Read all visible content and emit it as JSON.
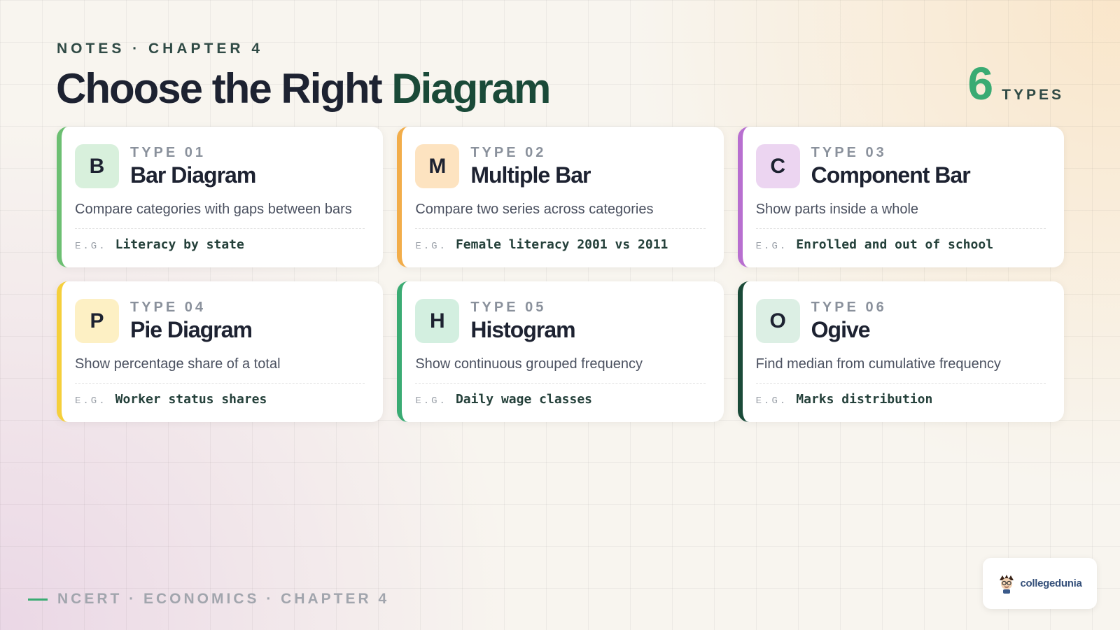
{
  "header": {
    "eyebrow": "NOTES · CHAPTER 4",
    "title_main": "Choose the Right",
    "title_accent": "Diagram",
    "count_value": "6",
    "count_label": "TYPES"
  },
  "colors": {
    "accent_green": "#3aab73",
    "dark_green": "#1a4a38",
    "title_dark": "#1d2231"
  },
  "example_prefix": "E.G.",
  "cards": [
    {
      "letter": "B",
      "type_label": "TYPE 01",
      "title": "Bar Diagram",
      "description": "Compare categories with gaps between bars",
      "example": "Literacy by state",
      "border_color": "#6cbf72",
      "badge_color": "#d8f0dc"
    },
    {
      "letter": "M",
      "type_label": "TYPE 02",
      "title": "Multiple Bar",
      "description": "Compare two series across categories",
      "example": "Female literacy 2001 vs 2011",
      "border_color": "#f2ad4a",
      "badge_color": "#fde3c0"
    },
    {
      "letter": "C",
      "type_label": "TYPE 03",
      "title": "Component Bar",
      "description": "Show parts inside a whole",
      "example": "Enrolled and out of school",
      "border_color": "#b86fd0",
      "badge_color": "#ecd5f1"
    },
    {
      "letter": "P",
      "type_label": "TYPE 04",
      "title": "Pie Diagram",
      "description": "Show percentage share of a total",
      "example": "Worker status shares",
      "border_color": "#f5cf3b",
      "badge_color": "#fdf0c4"
    },
    {
      "letter": "H",
      "type_label": "TYPE 05",
      "title": "Histogram",
      "description": "Show continuous grouped frequency",
      "example": "Daily wage classes",
      "border_color": "#3aab73",
      "badge_color": "#d3efe0"
    },
    {
      "letter": "O",
      "type_label": "TYPE 06",
      "title": "Ogive",
      "description": "Find median from cumulative frequency",
      "example": "Marks distribution",
      "border_color": "#1a4a38",
      "badge_color": "#dcefe4"
    }
  ],
  "footer": {
    "text": "NCERT · ECONOMICS · CHAPTER 4"
  },
  "logo": {
    "text": "collegedunia",
    "icon": "mascot-icon"
  }
}
